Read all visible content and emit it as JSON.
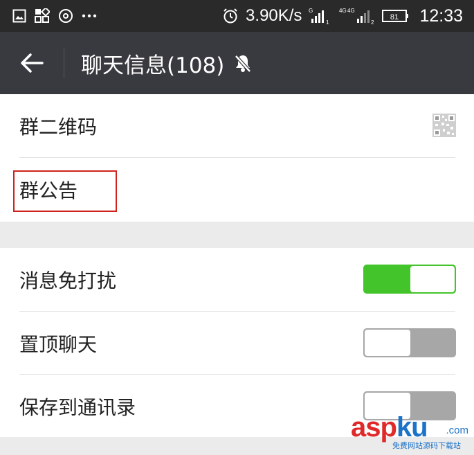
{
  "status_bar": {
    "net_speed": "3.90K/s",
    "time": "12:33",
    "battery": "81",
    "network_1": "G",
    "network_2": "4G",
    "network_3": "4G",
    "sim_1": "1",
    "sim_2": "2",
    "icons": [
      "image-icon",
      "apps-icon",
      "music-disc-icon",
      "more-dots-icon",
      "alarm-icon",
      "signal-icon",
      "battery-icon"
    ]
  },
  "header": {
    "title": "聊天信息(108)",
    "back_icon": "back-arrow-icon",
    "mute_icon": "mute-bell-icon"
  },
  "section_1": {
    "items": [
      {
        "label": "群二维码",
        "icon": "qr-code-icon"
      },
      {
        "label": "群公告"
      }
    ]
  },
  "section_2": {
    "items": [
      {
        "label": "消息免打扰",
        "toggle": true
      },
      {
        "label": "置顶聊天",
        "toggle": false
      },
      {
        "label": "保存到通讯录",
        "toggle": false
      }
    ]
  },
  "watermark": {
    "brand_a": "asp",
    "brand_b": "ku",
    "domain": ".com",
    "sub": "免费网站源码下载站"
  },
  "colors": {
    "title_bar": "#393a3f",
    "status_bar": "#2a2a2a",
    "toggle_on": "#43c42a",
    "toggle_off": "#a7a7a7",
    "highlight": "#d0211c"
  }
}
